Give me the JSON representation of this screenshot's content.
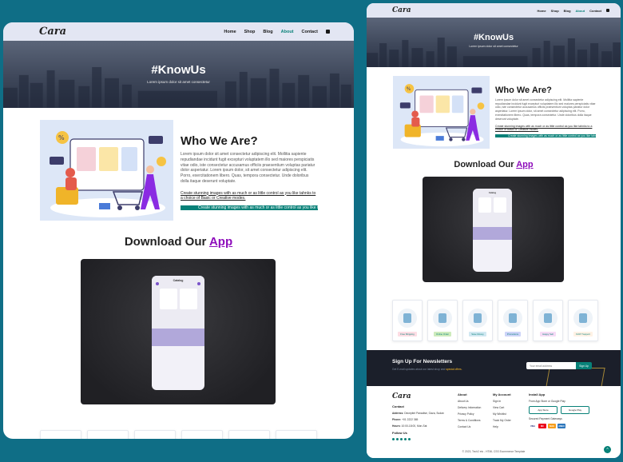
{
  "brand": {
    "logo": "Cara",
    "accent": "#088178",
    "app_highlight": "#8e0dbb",
    "hero_bg": "#3e475a"
  },
  "nav": {
    "items": [
      {
        "label": "Home",
        "active": false
      },
      {
        "label": "Shop",
        "active": false
      },
      {
        "label": "Blog",
        "active": false
      },
      {
        "label": "About",
        "active": true
      },
      {
        "label": "Contact",
        "active": false
      }
    ],
    "cart_icon": "shopping-bag-icon"
  },
  "hero": {
    "title": "#KnowUs",
    "subtitle": "Lorem ipsum dolor sit amet consectetur"
  },
  "about": {
    "title": "Who We Are?",
    "paragraph": "Lorem ipsum dolor sit amet consectetur adipiscing elit. Mollitia sapiente repudiandae incidunt fugit excepturi voluptatem illo sed maiores perspiciatis vitae odio, iste consectetur accusamus officiis praesentium voluptas pariatur dolor asperiatur. Lorem ipsum dolor, sit amet consectetur adipiscing elit. Porro, exercitationem libero. Quas, tempora consectetur. Unde doloribus dolla itaque deserunt voluptate.",
    "link": "Create stunning images with as much or as little control as you like tahnks to a choice of Basic or Creative modes.",
    "marquee": "Create stunning images with as much or as little control as you like tahnks to a choice of Basic or Creative modes."
  },
  "download": {
    "title": "Download Our",
    "app_word": "App",
    "phone_label": "Catalog"
  },
  "features": [
    {
      "label": "Free Shipping",
      "color": "#fddde4"
    },
    {
      "label": "Online Order",
      "color": "#cdebbc"
    },
    {
      "label": "Save Money",
      "color": "#d1e8f2"
    },
    {
      "label": "Promotions",
      "color": "#cdd4f8"
    },
    {
      "label": "Happy Sell",
      "color": "#f6dbf6"
    },
    {
      "label": "F24/7 Support",
      "color": "#fff2e5"
    }
  ],
  "newsletter": {
    "title": "Sign Up For Newsletters",
    "subtitle": "Get E-mail updates about our latest shop and",
    "highlight": "special offers.",
    "placeholder": "Your email address",
    "button": "Sign Up"
  },
  "footer": {
    "logo": "Cara",
    "contact": {
      "heading": "Contact",
      "address_label": "Address:",
      "address": "Deceptint Panadise, Gaza, Sudan",
      "phone_label": "Phone:",
      "phone": "+01 2222 365",
      "hours_label": "Hours:",
      "hours": "10:00-18:00, Mon-Sat",
      "follow": "Follow Us"
    },
    "about": {
      "heading": "About",
      "links": [
        "About Us",
        "Delivery Information",
        "Privacy Policy",
        "Terms & Conditions",
        "Contact Us"
      ]
    },
    "account": {
      "heading": "My Account",
      "links": [
        "Sign In",
        "View Cart",
        "My Wishlist",
        "Track My Order",
        "Help"
      ]
    },
    "install": {
      "heading": "Install App",
      "subtitle": "From App Store or Google Play",
      "app_store": "App Store",
      "google_play": "Google Play",
      "secured": "Secured Payment Gateways",
      "payments": [
        "VISA",
        "MC",
        "MAE",
        "AMEX"
      ]
    },
    "copyright": "© 2023, Tech2 etc - HTML CSS Ecommerce Template"
  }
}
